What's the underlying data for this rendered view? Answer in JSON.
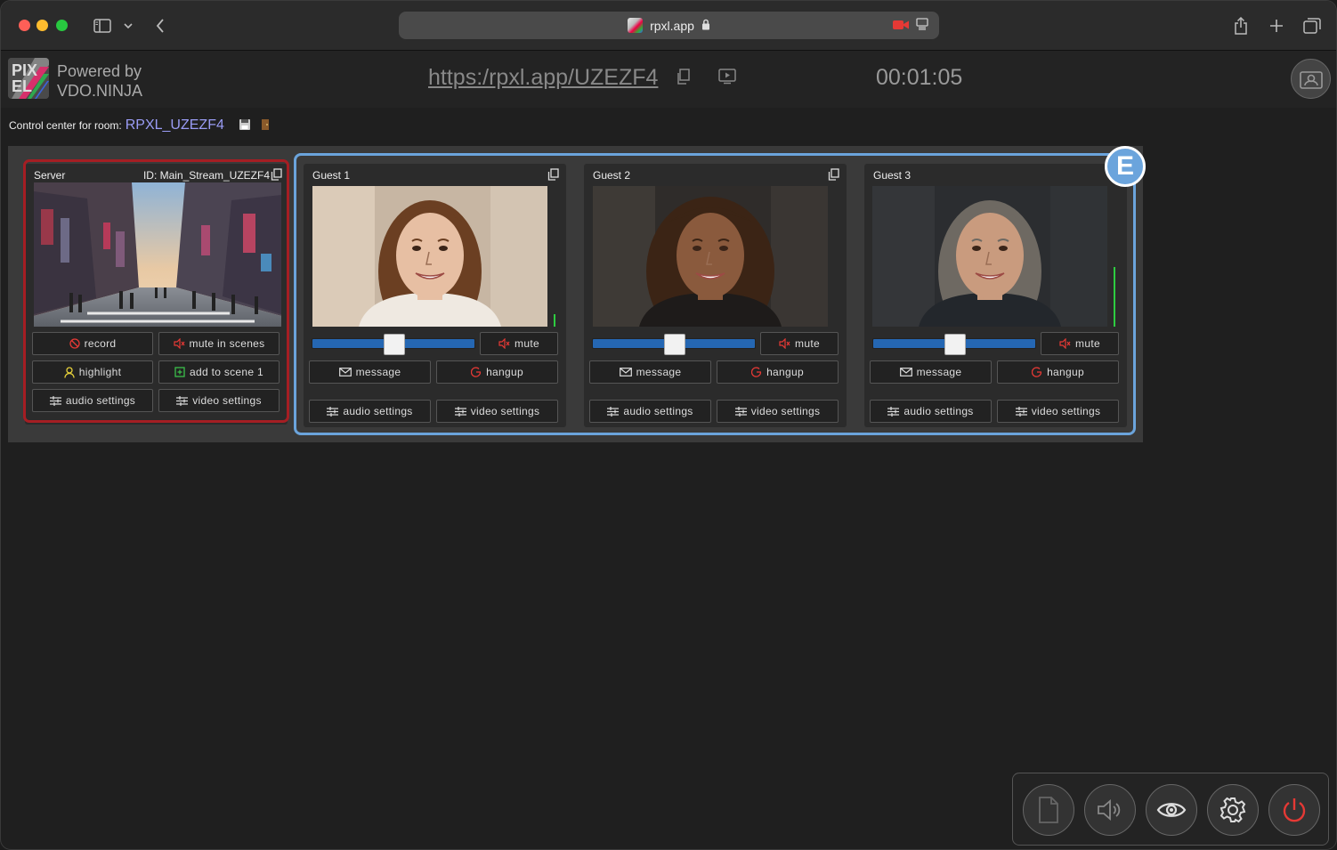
{
  "browser": {
    "address": "rpxl.app"
  },
  "header": {
    "powered_line1": "Powered by",
    "powered_line2": "VDO.NINJA",
    "room_url": "https:/rpxl.app/UZEZF4 ",
    "timer": "00:01:05",
    "logo_text": "PIX"
  },
  "control": {
    "label": "Control center for room:",
    "room": "RPXL_UZEZF4"
  },
  "server": {
    "title": "Server",
    "id": "ID: Main_Stream_UZEZF4",
    "record": "record",
    "mute_in_scenes": "mute in scenes",
    "highlight": "highlight",
    "add_to_scene": "add to scene 1",
    "audio_settings": "audio settings",
    "video_settings": "video settings"
  },
  "guests": [
    {
      "title": "Guest 1",
      "mute": "mute",
      "message": "message",
      "hangup": "hangup",
      "audio_settings": "audio settings",
      "video_settings": "video settings",
      "volume": 0.5,
      "level": 0.09
    },
    {
      "title": "Guest 2",
      "mute": "mute",
      "message": "message",
      "hangup": "hangup",
      "audio_settings": "audio settings",
      "video_settings": "video settings",
      "volume": 0.5,
      "level": 0
    },
    {
      "title": "Guest 3",
      "mute": "mute",
      "message": "message",
      "hangup": "hangup",
      "audio_settings": "audio settings",
      "video_settings": "video settings",
      "volume": 0.5,
      "level": 0.42
    }
  ],
  "annotation_badge": "E",
  "colors": {
    "server_outline": "#a51e23",
    "guests_outline": "#6ba4dc",
    "slider": "#2567b3",
    "room_name": "#9a9cf5",
    "level": "#2ecc40",
    "power": "#e53935"
  },
  "dock_icons": [
    "document-icon",
    "speaker-icon",
    "eye-icon",
    "gear-icon",
    "power-icon"
  ]
}
